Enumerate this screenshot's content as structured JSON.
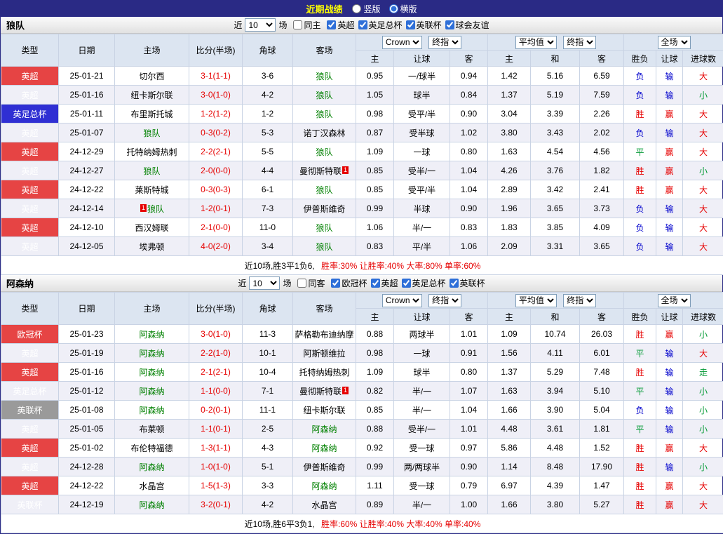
{
  "topbar": {
    "title": "近期战绩",
    "radios": [
      {
        "label": "竖版",
        "selected": false
      },
      {
        "label": "横版",
        "selected": true
      }
    ]
  },
  "table_headers": {
    "type": "类型",
    "date": "日期",
    "home": "主场",
    "score": "比分(半场)",
    "corner": "角球",
    "away": "客场",
    "odds_source": "Crown",
    "final_label": "终指",
    "avg_label": "平均值",
    "scope_label": "全场",
    "h": "主",
    "handicap": "让球",
    "a": "客",
    "draw": "和",
    "outcome": "胜负",
    "handicap_result": "让球",
    "goals": "进球数"
  },
  "colors": {
    "league_red": "#e64444",
    "league_blue": "#2f2fd3",
    "league_gray": "#9a9a9a",
    "result_red": "#e60000",
    "result_green": "#009933",
    "result_blue": "#0000cc",
    "focus_team_green": "#008000",
    "score_red": "#e60000",
    "topbar_bg": "#2a2a85",
    "title_yellow": "#ffff00"
  },
  "sections": [
    {
      "team": "狼队",
      "filter": {
        "near_label": "近",
        "count": "10",
        "games_label": "场",
        "same_label": "同主",
        "same_checked": false,
        "leagues": [
          {
            "label": "英超",
            "checked": true
          },
          {
            "label": "英足总杯",
            "checked": true
          },
          {
            "label": "英联杯",
            "checked": true
          },
          {
            "label": "球会友谊",
            "checked": true
          }
        ]
      },
      "rows": [
        {
          "lg": "英超",
          "lgc": "red",
          "date": "25-01-21",
          "home": "切尔西",
          "score": "3-1(1-1)",
          "corner": "3-6",
          "away": "狼队",
          "o1": "0.95",
          "o2": "一/球半",
          "o3": "0.94",
          "a1": "1.42",
          "a2": "5.16",
          "a3": "6.59",
          "r1": "负",
          "r2": "输",
          "r3": "大"
        },
        {
          "lg": "英超",
          "lgc": "red",
          "date": "25-01-16",
          "home": "纽卡斯尔联",
          "score": "3-0(1-0)",
          "corner": "4-2",
          "away": "狼队",
          "o1": "1.05",
          "o2": "球半",
          "o3": "0.84",
          "a1": "1.37",
          "a2": "5.19",
          "a3": "7.59",
          "r1": "负",
          "r2": "输",
          "r3": "小"
        },
        {
          "lg": "英足总杯",
          "lgc": "blue",
          "date": "25-01-11",
          "home": "布里斯托城",
          "score": "1-2(1-2)",
          "corner": "1-2",
          "away": "狼队",
          "o1": "0.98",
          "o2": "受平/半",
          "o3": "0.90",
          "a1": "3.04",
          "a2": "3.39",
          "a3": "2.26",
          "r1": "胜",
          "r2": "赢",
          "r3": "大"
        },
        {
          "lg": "英超",
          "lgc": "red",
          "date": "25-01-07",
          "home": "狼队",
          "score": "0-3(0-2)",
          "corner": "5-3",
          "away": "诺丁汉森林",
          "o1": "0.87",
          "o2": "受半球",
          "o3": "1.02",
          "a1": "3.80",
          "a2": "3.43",
          "a3": "2.02",
          "r1": "负",
          "r2": "输",
          "r3": "大"
        },
        {
          "lg": "英超",
          "lgc": "red",
          "date": "24-12-29",
          "home": "托特纳姆热刺",
          "score": "2-2(2-1)",
          "corner": "5-5",
          "away": "狼队",
          "o1": "1.09",
          "o2": "一球",
          "o3": "0.80",
          "a1": "1.63",
          "a2": "4.54",
          "a3": "4.56",
          "r1": "平",
          "r2": "赢",
          "r3": "大"
        },
        {
          "lg": "英超",
          "lgc": "red",
          "date": "24-12-27",
          "home": "狼队",
          "score": "2-0(0-0)",
          "corner": "4-4",
          "away": "曼彻斯特联",
          "acard_after": "1",
          "o1": "0.85",
          "o2": "受半/一",
          "o3": "1.04",
          "a1": "4.26",
          "a2": "3.76",
          "a3": "1.82",
          "r1": "胜",
          "r2": "赢",
          "r3": "小"
        },
        {
          "lg": "英超",
          "lgc": "red",
          "date": "24-12-22",
          "home": "莱斯特城",
          "score": "0-3(0-3)",
          "corner": "6-1",
          "away": "狼队",
          "o1": "0.85",
          "o2": "受平/半",
          "o3": "1.04",
          "a1": "2.89",
          "a2": "3.42",
          "a3": "2.41",
          "r1": "胜",
          "r2": "赢",
          "r3": "大"
        },
        {
          "lg": "英超",
          "lgc": "red",
          "date": "24-12-14",
          "home": "狼队",
          "hcard_before": "1",
          "score": "1-2(0-1)",
          "corner": "7-3",
          "away": "伊普斯维奇",
          "o1": "0.99",
          "o2": "半球",
          "o3": "0.90",
          "a1": "1.96",
          "a2": "3.65",
          "a3": "3.73",
          "r1": "负",
          "r2": "输",
          "r3": "大"
        },
        {
          "lg": "英超",
          "lgc": "red",
          "date": "24-12-10",
          "home": "西汉姆联",
          "score": "2-1(0-0)",
          "corner": "11-0",
          "away": "狼队",
          "o1": "1.06",
          "o2": "半/一",
          "o3": "0.83",
          "a1": "1.83",
          "a2": "3.85",
          "a3": "4.09",
          "r1": "负",
          "r2": "输",
          "r3": "大"
        },
        {
          "lg": "英超",
          "lgc": "red",
          "date": "24-12-05",
          "home": "埃弗顿",
          "score": "4-0(2-0)",
          "corner": "3-4",
          "away": "狼队",
          "o1": "0.83",
          "o2": "平/半",
          "o3": "1.06",
          "a1": "2.09",
          "a2": "3.31",
          "a3": "3.65",
          "r1": "负",
          "r2": "输",
          "r3": "大"
        }
      ],
      "summary": {
        "prefix": "近10场,胜3平1负6,",
        "stats": "胜率:30% 让胜率:40% 大率:80% 单率:60%"
      }
    },
    {
      "team": "阿森纳",
      "filter": {
        "near_label": "近",
        "count": "10",
        "games_label": "场",
        "same_label": "同客",
        "same_checked": false,
        "leagues": [
          {
            "label": "欧冠杯",
            "checked": true
          },
          {
            "label": "英超",
            "checked": true
          },
          {
            "label": "英足总杯",
            "checked": true
          },
          {
            "label": "英联杯",
            "checked": true
          }
        ]
      },
      "rows": [
        {
          "lg": "欧冠杯",
          "lgc": "red",
          "date": "25-01-23",
          "home": "阿森纳",
          "score": "3-0(1-0)",
          "corner": "11-3",
          "away": "萨格勒布迪纳摩",
          "o1": "0.88",
          "o2": "两球半",
          "o3": "1.01",
          "a1": "1.09",
          "a2": "10.74",
          "a3": "26.03",
          "r1": "胜",
          "r2": "赢",
          "r3": "小"
        },
        {
          "lg": "英超",
          "lgc": "red",
          "date": "25-01-19",
          "home": "阿森纳",
          "score": "2-2(1-0)",
          "corner": "10-1",
          "away": "阿斯顿维拉",
          "o1": "0.98",
          "o2": "一球",
          "o3": "0.91",
          "a1": "1.56",
          "a2": "4.11",
          "a3": "6.01",
          "r1": "平",
          "r2": "输",
          "r3": "大"
        },
        {
          "lg": "英超",
          "lgc": "red",
          "date": "25-01-16",
          "home": "阿森纳",
          "score": "2-1(2-1)",
          "corner": "10-4",
          "away": "托特纳姆热刺",
          "o1": "1.09",
          "o2": "球半",
          "o3": "0.80",
          "a1": "1.37",
          "a2": "5.29",
          "a3": "7.48",
          "r1": "胜",
          "r2": "输",
          "r3": "走"
        },
        {
          "lg": "英足总杯",
          "lgc": "blue",
          "date": "25-01-12",
          "home": "阿森纳",
          "score": "1-1(0-0)",
          "corner": "7-1",
          "away": "曼彻斯特联",
          "acard_after": "1",
          "o1": "0.82",
          "o2": "半/一",
          "o3": "1.07",
          "a1": "1.63",
          "a2": "3.94",
          "a3": "5.10",
          "r1": "平",
          "r2": "输",
          "r3": "小"
        },
        {
          "lg": "英联杯",
          "lgc": "gray",
          "date": "25-01-08",
          "home": "阿森纳",
          "score": "0-2(0-1)",
          "corner": "11-1",
          "away": "纽卡斯尔联",
          "o1": "0.85",
          "o2": "半/一",
          "o3": "1.04",
          "a1": "1.66",
          "a2": "3.90",
          "a3": "5.04",
          "r1": "负",
          "r2": "输",
          "r3": "小"
        },
        {
          "lg": "英超",
          "lgc": "red",
          "date": "25-01-05",
          "home": "布莱顿",
          "score": "1-1(0-1)",
          "corner": "2-5",
          "away": "阿森纳",
          "o1": "0.88",
          "o2": "受半/一",
          "o3": "1.01",
          "a1": "4.48",
          "a2": "3.61",
          "a3": "1.81",
          "r1": "平",
          "r2": "输",
          "r3": "小"
        },
        {
          "lg": "英超",
          "lgc": "red",
          "date": "25-01-02",
          "home": "布伦特福德",
          "score": "1-3(1-1)",
          "corner": "4-3",
          "away": "阿森纳",
          "o1": "0.92",
          "o2": "受一球",
          "o3": "0.97",
          "a1": "5.86",
          "a2": "4.48",
          "a3": "1.52",
          "r1": "胜",
          "r2": "赢",
          "r3": "大"
        },
        {
          "lg": "英超",
          "lgc": "red",
          "date": "24-12-28",
          "home": "阿森纳",
          "score": "1-0(1-0)",
          "corner": "5-1",
          "away": "伊普斯维奇",
          "o1": "0.99",
          "o2": "两/两球半",
          "o3": "0.90",
          "a1": "1.14",
          "a2": "8.48",
          "a3": "17.90",
          "r1": "胜",
          "r2": "输",
          "r3": "小"
        },
        {
          "lg": "英超",
          "lgc": "red",
          "date": "24-12-22",
          "home": "水晶宫",
          "score": "1-5(1-3)",
          "corner": "3-3",
          "away": "阿森纳",
          "o1": "1.11",
          "o2": "受一球",
          "o3": "0.79",
          "a1": "6.97",
          "a2": "4.39",
          "a3": "1.47",
          "r1": "胜",
          "r2": "赢",
          "r3": "大"
        },
        {
          "lg": "英联杯",
          "lgc": "gray",
          "date": "24-12-19",
          "home": "阿森纳",
          "score": "3-2(0-1)",
          "corner": "4-2",
          "away": "水晶宫",
          "o1": "0.89",
          "o2": "半/一",
          "o3": "1.00",
          "a1": "1.66",
          "a2": "3.80",
          "a3": "5.27",
          "r1": "胜",
          "r2": "赢",
          "r3": "大"
        }
      ],
      "summary": {
        "prefix": "近10场,胜6平3负1,",
        "stats": "胜率:60% 让胜率:40% 大率:40% 单率:40%"
      }
    }
  ]
}
